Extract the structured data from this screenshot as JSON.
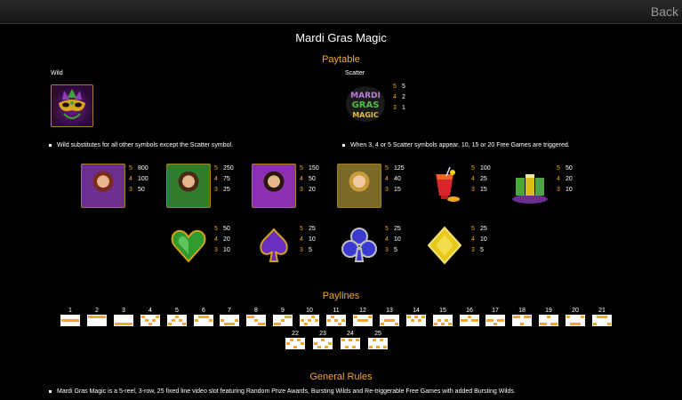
{
  "header": {
    "back_label": "Back"
  },
  "title": "Mardi Gras Magic",
  "paytable": {
    "heading": "Paytable",
    "wild": {
      "label": "Wild",
      "note": "Wild substitutes for all other symbols except the Scatter symbol."
    },
    "scatter": {
      "label": "Scatter",
      "logo_text": "MARDI GRAS MAGIC",
      "pays": [
        {
          "count": "5",
          "value": "5"
        },
        {
          "count": "4",
          "value": "2"
        },
        {
          "count": "3",
          "value": "1"
        }
      ],
      "note": "When 3, 4 or 5 Scatter symbols appear, 10, 15 or 20 Free Games are triggered."
    },
    "symbols": [
      {
        "name": "purple-lady",
        "pays": [
          {
            "count": "5",
            "value": "800"
          },
          {
            "count": "4",
            "value": "100"
          },
          {
            "count": "3",
            "value": "50"
          }
        ]
      },
      {
        "name": "green-lady",
        "pays": [
          {
            "count": "5",
            "value": "250"
          },
          {
            "count": "4",
            "value": "75"
          },
          {
            "count": "3",
            "value": "25"
          }
        ]
      },
      {
        "name": "violet-lady",
        "pays": [
          {
            "count": "5",
            "value": "150"
          },
          {
            "count": "4",
            "value": "50"
          },
          {
            "count": "3",
            "value": "20"
          }
        ]
      },
      {
        "name": "gold-lady",
        "pays": [
          {
            "count": "5",
            "value": "125"
          },
          {
            "count": "4",
            "value": "40"
          },
          {
            "count": "3",
            "value": "15"
          }
        ]
      },
      {
        "name": "cocktail",
        "pays": [
          {
            "count": "5",
            "value": "100"
          },
          {
            "count": "4",
            "value": "25"
          },
          {
            "count": "3",
            "value": "15"
          }
        ]
      },
      {
        "name": "shot-glasses",
        "pays": [
          {
            "count": "5",
            "value": "50"
          },
          {
            "count": "4",
            "value": "20"
          },
          {
            "count": "3",
            "value": "10"
          }
        ]
      },
      {
        "name": "heart",
        "pays": [
          {
            "count": "5",
            "value": "50"
          },
          {
            "count": "4",
            "value": "20"
          },
          {
            "count": "3",
            "value": "10"
          }
        ]
      },
      {
        "name": "spade",
        "pays": [
          {
            "count": "5",
            "value": "25"
          },
          {
            "count": "4",
            "value": "10"
          },
          {
            "count": "3",
            "value": "5"
          }
        ]
      },
      {
        "name": "club",
        "pays": [
          {
            "count": "5",
            "value": "25"
          },
          {
            "count": "4",
            "value": "10"
          },
          {
            "count": "3",
            "value": "5"
          }
        ]
      },
      {
        "name": "diamond",
        "pays": [
          {
            "count": "5",
            "value": "25"
          },
          {
            "count": "4",
            "value": "10"
          },
          {
            "count": "3",
            "value": "5"
          }
        ]
      }
    ]
  },
  "paylines": {
    "heading": "Paylines",
    "lines": [
      {
        "number": "1",
        "rows": [
          1,
          1,
          1,
          1,
          1
        ]
      },
      {
        "number": "2",
        "rows": [
          0,
          0,
          0,
          0,
          0
        ]
      },
      {
        "number": "3",
        "rows": [
          2,
          2,
          2,
          2,
          2
        ]
      },
      {
        "number": "4",
        "rows": [
          0,
          1,
          2,
          1,
          0
        ]
      },
      {
        "number": "5",
        "rows": [
          2,
          1,
          0,
          1,
          2
        ]
      },
      {
        "number": "6",
        "rows": [
          1,
          0,
          0,
          0,
          1
        ]
      },
      {
        "number": "7",
        "rows": [
          1,
          2,
          2,
          2,
          1
        ]
      },
      {
        "number": "8",
        "rows": [
          0,
          0,
          1,
          2,
          2
        ]
      },
      {
        "number": "9",
        "rows": [
          2,
          2,
          1,
          0,
          0
        ]
      },
      {
        "number": "10",
        "rows": [
          1,
          2,
          1,
          0,
          1
        ]
      },
      {
        "number": "11",
        "rows": [
          1,
          0,
          1,
          2,
          1
        ]
      },
      {
        "number": "12",
        "rows": [
          0,
          1,
          1,
          1,
          0
        ]
      },
      {
        "number": "13",
        "rows": [
          2,
          1,
          1,
          1,
          2
        ]
      },
      {
        "number": "14",
        "rows": [
          0,
          1,
          0,
          1,
          0
        ]
      },
      {
        "number": "15",
        "rows": [
          2,
          1,
          2,
          1,
          2
        ]
      },
      {
        "number": "16",
        "rows": [
          1,
          1,
          0,
          1,
          1
        ]
      },
      {
        "number": "17",
        "rows": [
          1,
          1,
          2,
          1,
          1
        ]
      },
      {
        "number": "18",
        "rows": [
          0,
          0,
          2,
          0,
          0
        ]
      },
      {
        "number": "19",
        "rows": [
          2,
          2,
          0,
          2,
          2
        ]
      },
      {
        "number": "20",
        "rows": [
          0,
          2,
          2,
          2,
          0
        ]
      },
      {
        "number": "21",
        "rows": [
          2,
          0,
          0,
          0,
          2
        ]
      },
      {
        "number": "22",
        "rows": [
          1,
          0,
          2,
          0,
          1
        ]
      },
      {
        "number": "23",
        "rows": [
          1,
          2,
          0,
          2,
          1
        ]
      },
      {
        "number": "24",
        "rows": [
          0,
          2,
          0,
          2,
          0
        ]
      },
      {
        "number": "25",
        "rows": [
          2,
          0,
          2,
          0,
          2
        ]
      }
    ]
  },
  "general_rules": {
    "heading": "General Rules",
    "items": [
      "Mardi Gras Magic is a 5-reel, 3-row, 25 fixed line video slot featuring Random Prize Awards, Bursting Wilds and Re-triggerable Free Games with added Bursting Wilds."
    ]
  },
  "colors": {
    "accent": "#f5a623",
    "background": "#000000"
  }
}
